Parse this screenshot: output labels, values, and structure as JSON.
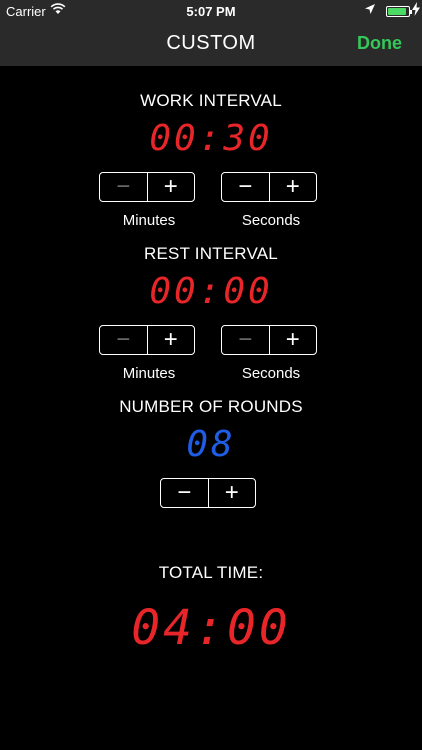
{
  "status_bar": {
    "carrier": "Carrier",
    "time": "5:07 PM"
  },
  "nav": {
    "title": "CUSTOM",
    "done_label": "Done"
  },
  "work": {
    "label": "WORK INTERVAL",
    "value": "00:30",
    "minutes_caption": "Minutes",
    "seconds_caption": "Seconds"
  },
  "rest": {
    "label": "REST INTERVAL",
    "value": "00:00",
    "minutes_caption": "Minutes",
    "seconds_caption": "Seconds"
  },
  "rounds": {
    "label": "NUMBER OF ROUNDS",
    "value": "08"
  },
  "total": {
    "label": "TOTAL TIME:",
    "value": "04:00"
  },
  "stepper_symbols": {
    "minus": "−",
    "plus": "+"
  },
  "colors": {
    "accent_done": "#34c759",
    "digit_red": "#e8262a",
    "digit_blue": "#1e5ee6"
  }
}
